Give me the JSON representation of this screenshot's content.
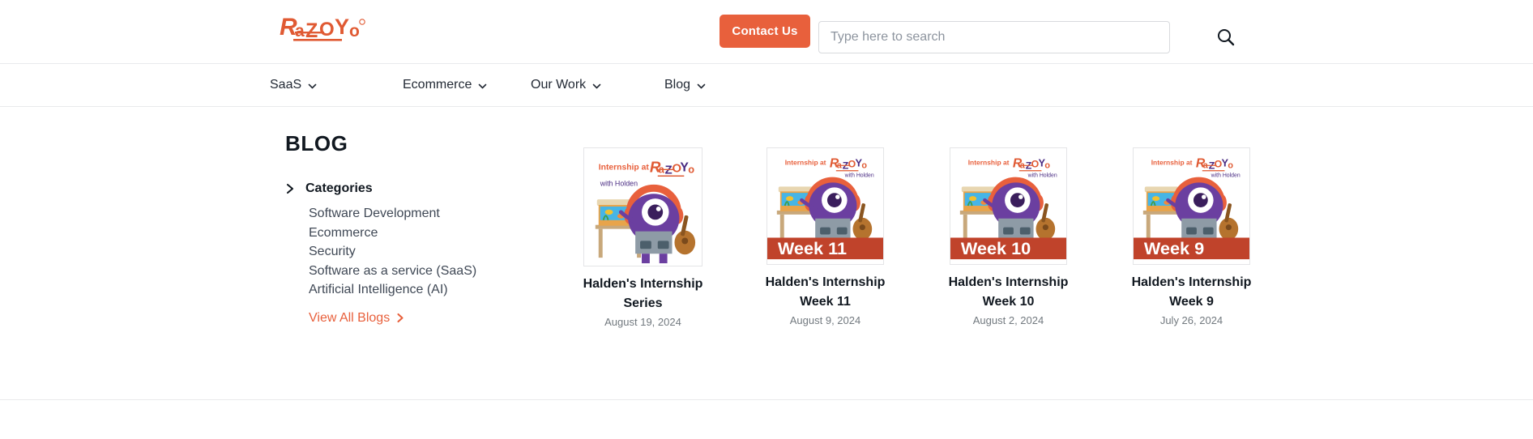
{
  "header": {
    "logo_text": "RaZOYO",
    "logo_trademark": "®",
    "contact_button": "Contact Us",
    "search": {
      "placeholder": "Type here to search",
      "value": "",
      "icon": "search-icon"
    }
  },
  "nav": {
    "items": [
      {
        "label": "SaaS",
        "icon": "chevron-down-icon"
      },
      {
        "label": "Ecommerce",
        "icon": "chevron-down-icon"
      },
      {
        "label": "Our Work",
        "icon": "chevron-down-icon"
      },
      {
        "label": "Blog",
        "icon": "chevron-down-icon"
      }
    ]
  },
  "sidebar": {
    "title": "BLOG",
    "categories_label": "Categories",
    "categories_icon": "chevron-right-icon",
    "categories": [
      "Software Development",
      "Ecommerce",
      "Security",
      "Software as a service (SaaS)",
      "Artificial Intelligence (AI)"
    ],
    "view_all": {
      "label": "View All Blogs",
      "icon": "chevron-right-icon"
    }
  },
  "cards": [
    {
      "title": "Halden's Internship Series",
      "date": "August 19, 2024",
      "thumb": {
        "heading": "Internship at",
        "brand": "RaZOYO",
        "subtitle": "with Holden",
        "badge": ""
      }
    },
    {
      "title": "Halden's Internship Week 11",
      "date": "August 9, 2024",
      "thumb": {
        "heading": "Internship at",
        "brand": "RaZOYO",
        "subtitle": "with Holden",
        "badge": "Week 11"
      }
    },
    {
      "title": "Halden's Internship Week 10",
      "date": "August 2, 2024",
      "thumb": {
        "heading": "Internship at",
        "brand": "RaZOYO",
        "subtitle": "with Holden",
        "badge": "Week 10"
      }
    },
    {
      "title": "Halden's Internship Week 9",
      "date": "July 26, 2024",
      "thumb": {
        "heading": "Internship at",
        "brand": "RaZOYO",
        "subtitle": "with Holden",
        "badge": "Week 9"
      }
    }
  ],
  "colors": {
    "brand_orange": "#E05A33",
    "button_orange": "#E8603C",
    "badge_red": "#C0432B",
    "text_dark": "#111820",
    "text_muted": "#72797f",
    "divider": "#e9eaec"
  }
}
